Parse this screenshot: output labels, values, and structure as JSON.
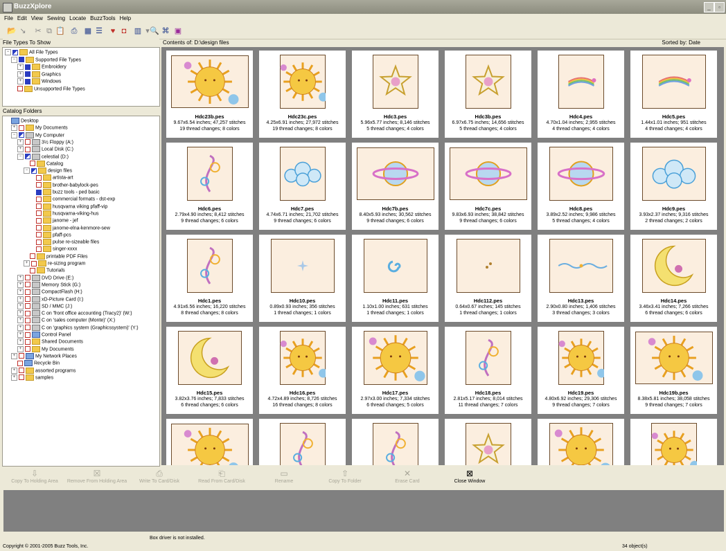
{
  "window": {
    "title": "BuzzXplore"
  },
  "menu": [
    "File",
    "Edit",
    "View",
    "Sewing",
    "Locate",
    "BuzzTools",
    "Help"
  ],
  "file_types": {
    "header": "File Types To Show",
    "items": [
      {
        "label": "All File Types",
        "level": 0,
        "exp": "−",
        "chk": "half"
      },
      {
        "label": "Supported File Types",
        "level": 1,
        "exp": "−",
        "chk": "blue"
      },
      {
        "label": "Embroidery",
        "level": 2,
        "exp": "+",
        "chk": "blue"
      },
      {
        "label": "Graphics",
        "level": 2,
        "exp": "+",
        "chk": "blue"
      },
      {
        "label": "Windows",
        "level": 2,
        "exp": "+",
        "chk": "blue"
      },
      {
        "label": "Unsupported File Types",
        "level": 1,
        "exp": "",
        "chk": "empty"
      }
    ]
  },
  "catalog": {
    "header": "Catalog Folders",
    "items": [
      {
        "label": "Desktop",
        "level": 0,
        "exp": "",
        "chk": "none",
        "icon": "blue"
      },
      {
        "label": "My Documents",
        "level": 1,
        "exp": "+",
        "chk": "empty",
        "icon": "folder"
      },
      {
        "label": "My Computer",
        "level": 1,
        "exp": "−",
        "chk": "half",
        "icon": "drive"
      },
      {
        "label": "3½ Floppy (A:)",
        "level": 2,
        "exp": "+",
        "chk": "empty",
        "icon": "drive"
      },
      {
        "label": "Local Disk (C:)",
        "level": 2,
        "exp": "+",
        "chk": "empty",
        "icon": "drive"
      },
      {
        "label": "celestial (D:)",
        "level": 2,
        "exp": "−",
        "chk": "half",
        "icon": "drive"
      },
      {
        "label": "Catalog",
        "level": 3,
        "exp": "",
        "chk": "empty",
        "icon": "folder"
      },
      {
        "label": "design files",
        "level": 3,
        "exp": "−",
        "chk": "half",
        "icon": "folder"
      },
      {
        "label": "artista-art",
        "level": 4,
        "exp": "",
        "chk": "empty",
        "icon": "folder"
      },
      {
        "label": "brother-babylock-pes",
        "level": 4,
        "exp": "",
        "chk": "empty",
        "icon": "folder"
      },
      {
        "label": "buzz tools - ped basic",
        "level": 4,
        "exp": "",
        "chk": "blue",
        "icon": "folder"
      },
      {
        "label": "commercial formats - dst-exp",
        "level": 4,
        "exp": "",
        "chk": "empty",
        "icon": "folder"
      },
      {
        "label": "husqvarna viking pfaff-vip",
        "level": 4,
        "exp": "",
        "chk": "empty",
        "icon": "folder"
      },
      {
        "label": "husqvarna-viking-hus",
        "level": 4,
        "exp": "",
        "chk": "empty",
        "icon": "folder"
      },
      {
        "label": "janome - jef",
        "level": 4,
        "exp": "",
        "chk": "empty",
        "icon": "folder"
      },
      {
        "label": "janome-elna-kenmore-sew",
        "level": 4,
        "exp": "",
        "chk": "empty",
        "icon": "folder"
      },
      {
        "label": "pfaff-pcs",
        "level": 4,
        "exp": "",
        "chk": "empty",
        "icon": "folder"
      },
      {
        "label": "pulse re-sizeable files",
        "level": 4,
        "exp": "",
        "chk": "empty",
        "icon": "folder"
      },
      {
        "label": "singer-xxxx",
        "level": 4,
        "exp": "",
        "chk": "empty",
        "icon": "folder"
      },
      {
        "label": "printable PDF Files",
        "level": 3,
        "exp": "",
        "chk": "empty",
        "icon": "folder"
      },
      {
        "label": "re-sizing program",
        "level": 3,
        "exp": "+",
        "chk": "empty",
        "icon": "folder"
      },
      {
        "label": "Tutorials",
        "level": 3,
        "exp": "",
        "chk": "empty",
        "icon": "folder"
      },
      {
        "label": "DVD Drive (E:)",
        "level": 2,
        "exp": "+",
        "chk": "empty",
        "icon": "drive"
      },
      {
        "label": "Memory Stick (G:)",
        "level": 2,
        "exp": "+",
        "chk": "empty",
        "icon": "drive"
      },
      {
        "label": "CompactFlash (H:)",
        "level": 2,
        "exp": "+",
        "chk": "empty",
        "icon": "drive"
      },
      {
        "label": "xD-Picture Card (I:)",
        "level": 2,
        "exp": "+",
        "chk": "empty",
        "icon": "drive"
      },
      {
        "label": "SD / MMC (J:)",
        "level": 2,
        "exp": "+",
        "chk": "empty",
        "icon": "drive"
      },
      {
        "label": "C on 'front office accounting (Tracy2)' (W:)",
        "level": 2,
        "exp": "+",
        "chk": "empty",
        "icon": "drive"
      },
      {
        "label": "C on 'sales computer (Monte)' (X:)",
        "level": 2,
        "exp": "+",
        "chk": "empty",
        "icon": "drive"
      },
      {
        "label": "C on 'graphics system (Graphicssystem)' (Y:)",
        "level": 2,
        "exp": "+",
        "chk": "empty",
        "icon": "drive"
      },
      {
        "label": "Control Panel",
        "level": 2,
        "exp": "+",
        "chk": "empty",
        "icon": "blue"
      },
      {
        "label": "Shared Documents",
        "level": 2,
        "exp": "+",
        "chk": "empty",
        "icon": "folder"
      },
      {
        "label": "My Documents",
        "level": 2,
        "exp": "+",
        "chk": "empty",
        "icon": "folder"
      },
      {
        "label": "My Network Places",
        "level": 1,
        "exp": "+",
        "chk": "empty",
        "icon": "blue"
      },
      {
        "label": "Recycle Bin",
        "level": 1,
        "exp": "",
        "chk": "empty",
        "icon": "blue"
      },
      {
        "label": "assorted programs",
        "level": 1,
        "exp": "+",
        "chk": "empty",
        "icon": "folder"
      },
      {
        "label": "samples",
        "level": 1,
        "exp": "+",
        "chk": "empty",
        "icon": "folder"
      }
    ]
  },
  "content": {
    "header": "Contents of: D:\\design files",
    "sorted": "Sorted by: Date",
    "tiles": [
      {
        "name": "Hdc23b.pes",
        "dims": "9.67x6.54 inches; 47,257 stitches",
        "threads": "19 thread changes; 8 colors",
        "art": "sun",
        "shape": "wide"
      },
      {
        "name": "Hdc23c.pes",
        "dims": "4.25x6.91 inches; 27,972 stitches",
        "threads": "19 thread changes; 8 colors",
        "art": "sun",
        "shape": "tall"
      },
      {
        "name": "Hdc3.pes",
        "dims": "5.96x5.77 inches; 8,146 stitches",
        "threads": "5 thread changes; 4 colors",
        "art": "star",
        "shape": "tall"
      },
      {
        "name": "Hdc3b.pes",
        "dims": "6.97x6.75 inches; 14,656 stitches",
        "threads": "5 thread changes; 4 colors",
        "art": "star",
        "shape": "tall"
      },
      {
        "name": "Hdc4.pes",
        "dims": "4.70x1.04 inches; 2,955 stitches",
        "threads": "4 thread changes; 4 colors",
        "art": "rainbow",
        "shape": "tall"
      },
      {
        "name": "Hdc5.pes",
        "dims": "1.44x1.01 inches; 951 stitches",
        "threads": "4 thread changes; 4 colors",
        "art": "rainbow",
        "shape": "square"
      },
      {
        "name": "Hdc6.pes",
        "dims": "2.79x4.90 inches; 8,412 stitches",
        "threads": "9 thread changes; 6 colors",
        "art": "swirl",
        "shape": "tall"
      },
      {
        "name": "Hdc7.pes",
        "dims": "4.74x6.71 inches; 21,702 stitches",
        "threads": "9 thread changes; 6 colors",
        "art": "cloud",
        "shape": "tall"
      },
      {
        "name": "Hdc7b.pes",
        "dims": "8.40x5.93 inches; 30,562 stitches",
        "threads": "9 thread changes; 6 colors",
        "art": "planet",
        "shape": "wide"
      },
      {
        "name": "Hdc7c.pes",
        "dims": "9.83x6.93 inches; 38,842 stitches",
        "threads": "9 thread changes; 6 colors",
        "art": "planet",
        "shape": "wide"
      },
      {
        "name": "Hdc8.pes",
        "dims": "3.89x2.52 inches; 9,986 stitches",
        "threads": "5 thread changes; 4 colors",
        "art": "planet",
        "shape": "square"
      },
      {
        "name": "Hdc9.pes",
        "dims": "3.93x2.37 inches; 9,316 stitches",
        "threads": "2 thread changes; 2 colors",
        "art": "cloud",
        "shape": "square"
      },
      {
        "name": "Hdc1.pes",
        "dims": "4.91x6.56 inches; 16,220 stitches",
        "threads": "8 thread changes; 8 colors",
        "art": "swirl",
        "shape": "tall"
      },
      {
        "name": "Hdc10.pes",
        "dims": "0.89x0.93 inches; 356 stitches",
        "threads": "1 thread changes; 1 colors",
        "art": "sparkle",
        "shape": "square"
      },
      {
        "name": "Hdc11.pes",
        "dims": "1.10x1.00 inches; 631 stitches",
        "threads": "1 thread changes; 1 colors",
        "art": "spiral",
        "shape": "square"
      },
      {
        "name": "Hdc112.pes",
        "dims": "0.64x0.67 inches; 145 stitches",
        "threads": "1 thread changes; 1 colors",
        "art": "dots",
        "shape": "square"
      },
      {
        "name": "Hdc13.pes",
        "dims": "2.90x0.80 inches; 1,406 stitches",
        "threads": "3 thread changes; 3 colors",
        "art": "border",
        "shape": "square"
      },
      {
        "name": "Hdc14.pes",
        "dims": "3.46x3.41 inches; 7,266 stitches",
        "threads": "6 thread changes; 6 colors",
        "art": "moon",
        "shape": "square"
      },
      {
        "name": "Hdc15.pes",
        "dims": "3.82x3.76 inches; 7,833 stitches",
        "threads": "6 thread changes; 6 colors",
        "art": "moon",
        "shape": "square"
      },
      {
        "name": "Hdc16.pes",
        "dims": "4.72x4.89 inches; 8,726 stitches",
        "threads": "16 thread changes; 8 colors",
        "art": "sun",
        "shape": "tall"
      },
      {
        "name": "Hdc17.pes",
        "dims": "2.97x3.00 inches; 7,334 stitches",
        "threads": "6 thread changes; 5 colors",
        "art": "sun",
        "shape": "square"
      },
      {
        "name": "Hdc18.pes",
        "dims": "2.81x5.17 inches; 8,014 stitches",
        "threads": "11 thread changes; 7 colors",
        "art": "swirl",
        "shape": "tall"
      },
      {
        "name": "Hdc19.pes",
        "dims": "4.80x6.92 inches; 29,306 stitches",
        "threads": "9 thread changes; 7 colors",
        "art": "sun",
        "shape": "tall"
      },
      {
        "name": "Hdc19b.pes",
        "dims": "8.38x5.81 inches; 38,058 stitches",
        "threads": "9 thread changes; 7 colors",
        "art": "sun",
        "shape": "wide"
      },
      {
        "name": "",
        "dims": "",
        "threads": "",
        "art": "sun",
        "shape": "wide"
      },
      {
        "name": "",
        "dims": "",
        "threads": "",
        "art": "swirl",
        "shape": "tall"
      },
      {
        "name": "",
        "dims": "",
        "threads": "",
        "art": "swirl",
        "shape": "tall"
      },
      {
        "name": "",
        "dims": "",
        "threads": "",
        "art": "star",
        "shape": "tall"
      },
      {
        "name": "",
        "dims": "",
        "threads": "",
        "art": "sun",
        "shape": "square"
      },
      {
        "name": "",
        "dims": "",
        "threads": "",
        "art": "sun",
        "shape": "tall"
      }
    ]
  },
  "actions": [
    {
      "label": "Copy To Holding Area",
      "icon": "⇩",
      "enabled": false
    },
    {
      "label": "Remove From Holding Area",
      "icon": "☒",
      "enabled": false
    },
    {
      "label": "Write To Card/Disk",
      "icon": "⎙",
      "enabled": false
    },
    {
      "label": "Read From Card/Disk",
      "icon": "⎗",
      "enabled": false
    },
    {
      "label": "Rename",
      "icon": "▭",
      "enabled": false
    },
    {
      "label": "Copy To Folder",
      "icon": "⇧",
      "enabled": false
    },
    {
      "label": "Erase Card",
      "icon": "✕",
      "enabled": false
    },
    {
      "label": "Close Window",
      "icon": "⊠",
      "enabled": true
    }
  ],
  "status": {
    "box": "Box driver is not installed.",
    "copyright": "Copyright © 2001-2005 Buzz Tools, Inc.",
    "objects": "34 object(s)"
  }
}
